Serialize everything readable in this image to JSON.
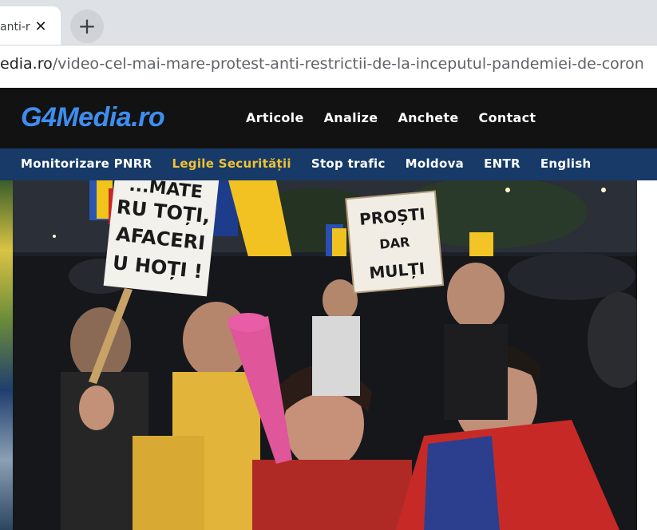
{
  "browser": {
    "tab_title": "anti-r",
    "tab_close_icon": "close-icon",
    "new_tab_icon": "plus-icon",
    "url_host": "edia.ro",
    "url_path": "/video-cel-mai-mare-protest-anti-restrictii-de-la-inceputul-pandemiei-de-coron"
  },
  "site": {
    "logo": "G4Media.ro",
    "main_nav": [
      "Articole",
      "Analize",
      "Anchete",
      "Contact"
    ],
    "sub_nav": [
      "Monitorizare PNRR",
      "Legile Securității",
      "Stop trafic",
      "Moldova",
      "ENTR",
      "English"
    ],
    "colors": {
      "header_bg": "#121212",
      "subnav_bg": "#173a68",
      "logo": "#3e8ef0",
      "highlight": "#f2c230"
    }
  },
  "photo": {
    "sign_left": [
      "...MATE",
      "RU TOȚI,",
      "AFACERI",
      "U HOȚI !"
    ],
    "sign_right": [
      "PROȘTI",
      "DAR",
      "MULȚI"
    ]
  }
}
